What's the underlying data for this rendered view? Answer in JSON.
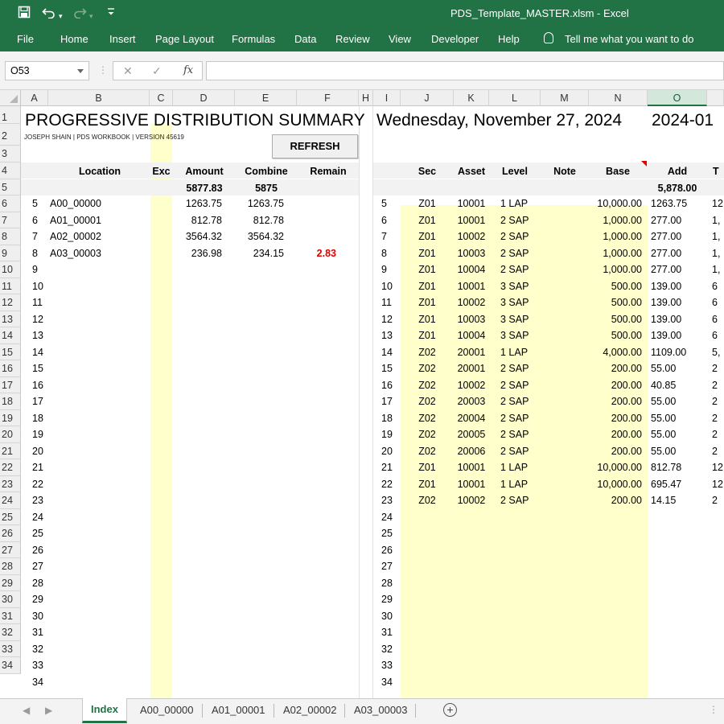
{
  "titlebar": {
    "save_icon": "save-icon",
    "undo_icon": "undo-icon",
    "redo_icon": "redo-icon",
    "customize_icon": "customize-quick-access-icon",
    "document_title": "PDS_Template_MASTER.xlsm  -  Excel"
  },
  "ribbon": {
    "tabs": [
      "File",
      "Home",
      "Insert",
      "Page Layout",
      "Formulas",
      "Data",
      "Review",
      "View",
      "Developer",
      "Help"
    ],
    "tell_me": "Tell me what you want to do"
  },
  "formula_bar": {
    "name_box": "O53",
    "cancel_glyph": "✕",
    "enter_glyph": "✓",
    "fx_label": "fx",
    "formula": ""
  },
  "columns": [
    {
      "letter": "A"
    },
    {
      "letter": "B"
    },
    {
      "letter": "C"
    },
    {
      "letter": "D"
    },
    {
      "letter": "E"
    },
    {
      "letter": "F"
    },
    {
      "letter": "H"
    },
    {
      "letter": "I"
    },
    {
      "letter": "J"
    },
    {
      "letter": "K"
    },
    {
      "letter": "L"
    },
    {
      "letter": "M"
    },
    {
      "letter": "N"
    },
    {
      "letter": "O"
    }
  ],
  "selected_column": "O",
  "sheet": {
    "title": "PROGRESSIVE DISTRIBUTION SUMMARY",
    "subtitle": "JOSEPH SHAIN | PDS WORKBOOK | VERSION 45619",
    "refresh_label": "REFRESH",
    "date": "Wednesday, November 27, 2024",
    "period": "2024-01",
    "left_headers": {
      "location": "Location",
      "exc": "Exc",
      "amount": "Amount",
      "combine": "Combine",
      "remain": "Remain"
    },
    "left_totals": {
      "amount": "5877.83",
      "combine": "5875"
    },
    "left_rows": [
      {
        "n": "5",
        "location": "A00_00000",
        "amount": "1263.75",
        "combine": "1263.75",
        "remain": ""
      },
      {
        "n": "6",
        "location": "A01_00001",
        "amount": "812.78",
        "combine": "812.78",
        "remain": ""
      },
      {
        "n": "7",
        "location": "A02_00002",
        "amount": "3564.32",
        "combine": "3564.32",
        "remain": ""
      },
      {
        "n": "8",
        "location": "A03_00003",
        "amount": "236.98",
        "combine": "234.15",
        "remain": "2.83"
      }
    ],
    "right_headers": {
      "sec": "Sec",
      "asset": "Asset",
      "level": "Level",
      "note": "Note",
      "base": "Base",
      "add": "Add",
      "clipped": "T"
    },
    "right_totals": {
      "add": "5,878.00"
    },
    "right_rows": [
      {
        "n": "5",
        "sec": "Z01",
        "asset": "10001",
        "level": "1 LAP",
        "base": "10,000.00",
        "add": "1263.75",
        "clipped": "12"
      },
      {
        "n": "6",
        "sec": "Z01",
        "asset": "10001",
        "level": "2 SAP",
        "base": "1,000.00",
        "add": "277.00",
        "clipped": "1,"
      },
      {
        "n": "7",
        "sec": "Z01",
        "asset": "10002",
        "level": "2 SAP",
        "base": "1,000.00",
        "add": "277.00",
        "clipped": "1,"
      },
      {
        "n": "8",
        "sec": "Z01",
        "asset": "10003",
        "level": "2 SAP",
        "base": "1,000.00",
        "add": "277.00",
        "clipped": "1,"
      },
      {
        "n": "9",
        "sec": "Z01",
        "asset": "10004",
        "level": "2 SAP",
        "base": "1,000.00",
        "add": "277.00",
        "clipped": "1,"
      },
      {
        "n": "10",
        "sec": "Z01",
        "asset": "10001",
        "level": "3 SAP",
        "base": "500.00",
        "add": "139.00",
        "clipped": "6"
      },
      {
        "n": "11",
        "sec": "Z01",
        "asset": "10002",
        "level": "3 SAP",
        "base": "500.00",
        "add": "139.00",
        "clipped": "6"
      },
      {
        "n": "12",
        "sec": "Z01",
        "asset": "10003",
        "level": "3 SAP",
        "base": "500.00",
        "add": "139.00",
        "clipped": "6"
      },
      {
        "n": "13",
        "sec": "Z01",
        "asset": "10004",
        "level": "3 SAP",
        "base": "500.00",
        "add": "139.00",
        "clipped": "6"
      },
      {
        "n": "14",
        "sec": "Z02",
        "asset": "20001",
        "level": "1 LAP",
        "base": "4,000.00",
        "add": "1109.00",
        "clipped": "5,"
      },
      {
        "n": "15",
        "sec": "Z02",
        "asset": "20001",
        "level": "2 SAP",
        "base": "200.00",
        "add": "55.00",
        "clipped": "2"
      },
      {
        "n": "16",
        "sec": "Z02",
        "asset": "10002",
        "level": "2 SAP",
        "base": "200.00",
        "add": "40.85",
        "clipped": "2"
      },
      {
        "n": "17",
        "sec": "Z02",
        "asset": "20003",
        "level": "2 SAP",
        "base": "200.00",
        "add": "55.00",
        "clipped": "2"
      },
      {
        "n": "18",
        "sec": "Z02",
        "asset": "20004",
        "level": "2 SAP",
        "base": "200.00",
        "add": "55.00",
        "clipped": "2"
      },
      {
        "n": "19",
        "sec": "Z02",
        "asset": "20005",
        "level": "2 SAP",
        "base": "200.00",
        "add": "55.00",
        "clipped": "2"
      },
      {
        "n": "20",
        "sec": "Z02",
        "asset": "20006",
        "level": "2 SAP",
        "base": "200.00",
        "add": "55.00",
        "clipped": "2"
      },
      {
        "n": "21",
        "sec": "Z01",
        "asset": "10001",
        "level": "1 LAP",
        "base": "10,000.00",
        "add": "812.78",
        "clipped": "12"
      },
      {
        "n": "22",
        "sec": "Z01",
        "asset": "10001",
        "level": "1 LAP",
        "base": "10,000.00",
        "add": "695.47",
        "clipped": "12"
      },
      {
        "n": "23",
        "sec": "Z02",
        "asset": "10002",
        "level": "2 SAP",
        "base": "200.00",
        "add": "14.15",
        "clipped": "2"
      }
    ],
    "index_rows_left": [
      "9",
      "10",
      "11",
      "12",
      "13",
      "14",
      "15",
      "16",
      "17",
      "18",
      "19",
      "20",
      "21",
      "22",
      "23",
      "24",
      "25",
      "26",
      "27",
      "28",
      "29",
      "30",
      "31",
      "32",
      "33",
      "34"
    ],
    "index_rows_right": [
      "24",
      "25",
      "26",
      "27",
      "28",
      "29",
      "30",
      "31",
      "32",
      "33",
      "34"
    ]
  },
  "row_numbers": [
    "1",
    "2",
    "3",
    "4",
    "5",
    "6",
    "7",
    "8",
    "9",
    "10",
    "11",
    "12",
    "13",
    "14",
    "15",
    "16",
    "17",
    "18",
    "19",
    "20",
    "21",
    "22",
    "23",
    "24",
    "25",
    "26",
    "27",
    "28",
    "29",
    "30",
    "31",
    "32",
    "33",
    "34"
  ],
  "sheet_tabs": {
    "prev_glyph": "◀",
    "next_glyph": "▶",
    "tabs": [
      "Index",
      "A00_00000",
      "A01_00001",
      "A02_00002",
      "A03_00003"
    ],
    "active": "Index",
    "add_glyph": "+",
    "more_glyph": "⋮"
  },
  "colors": {
    "excel_green": "#217346",
    "note_yellow": "#ffffcc",
    "remain_red": "#e00000"
  }
}
